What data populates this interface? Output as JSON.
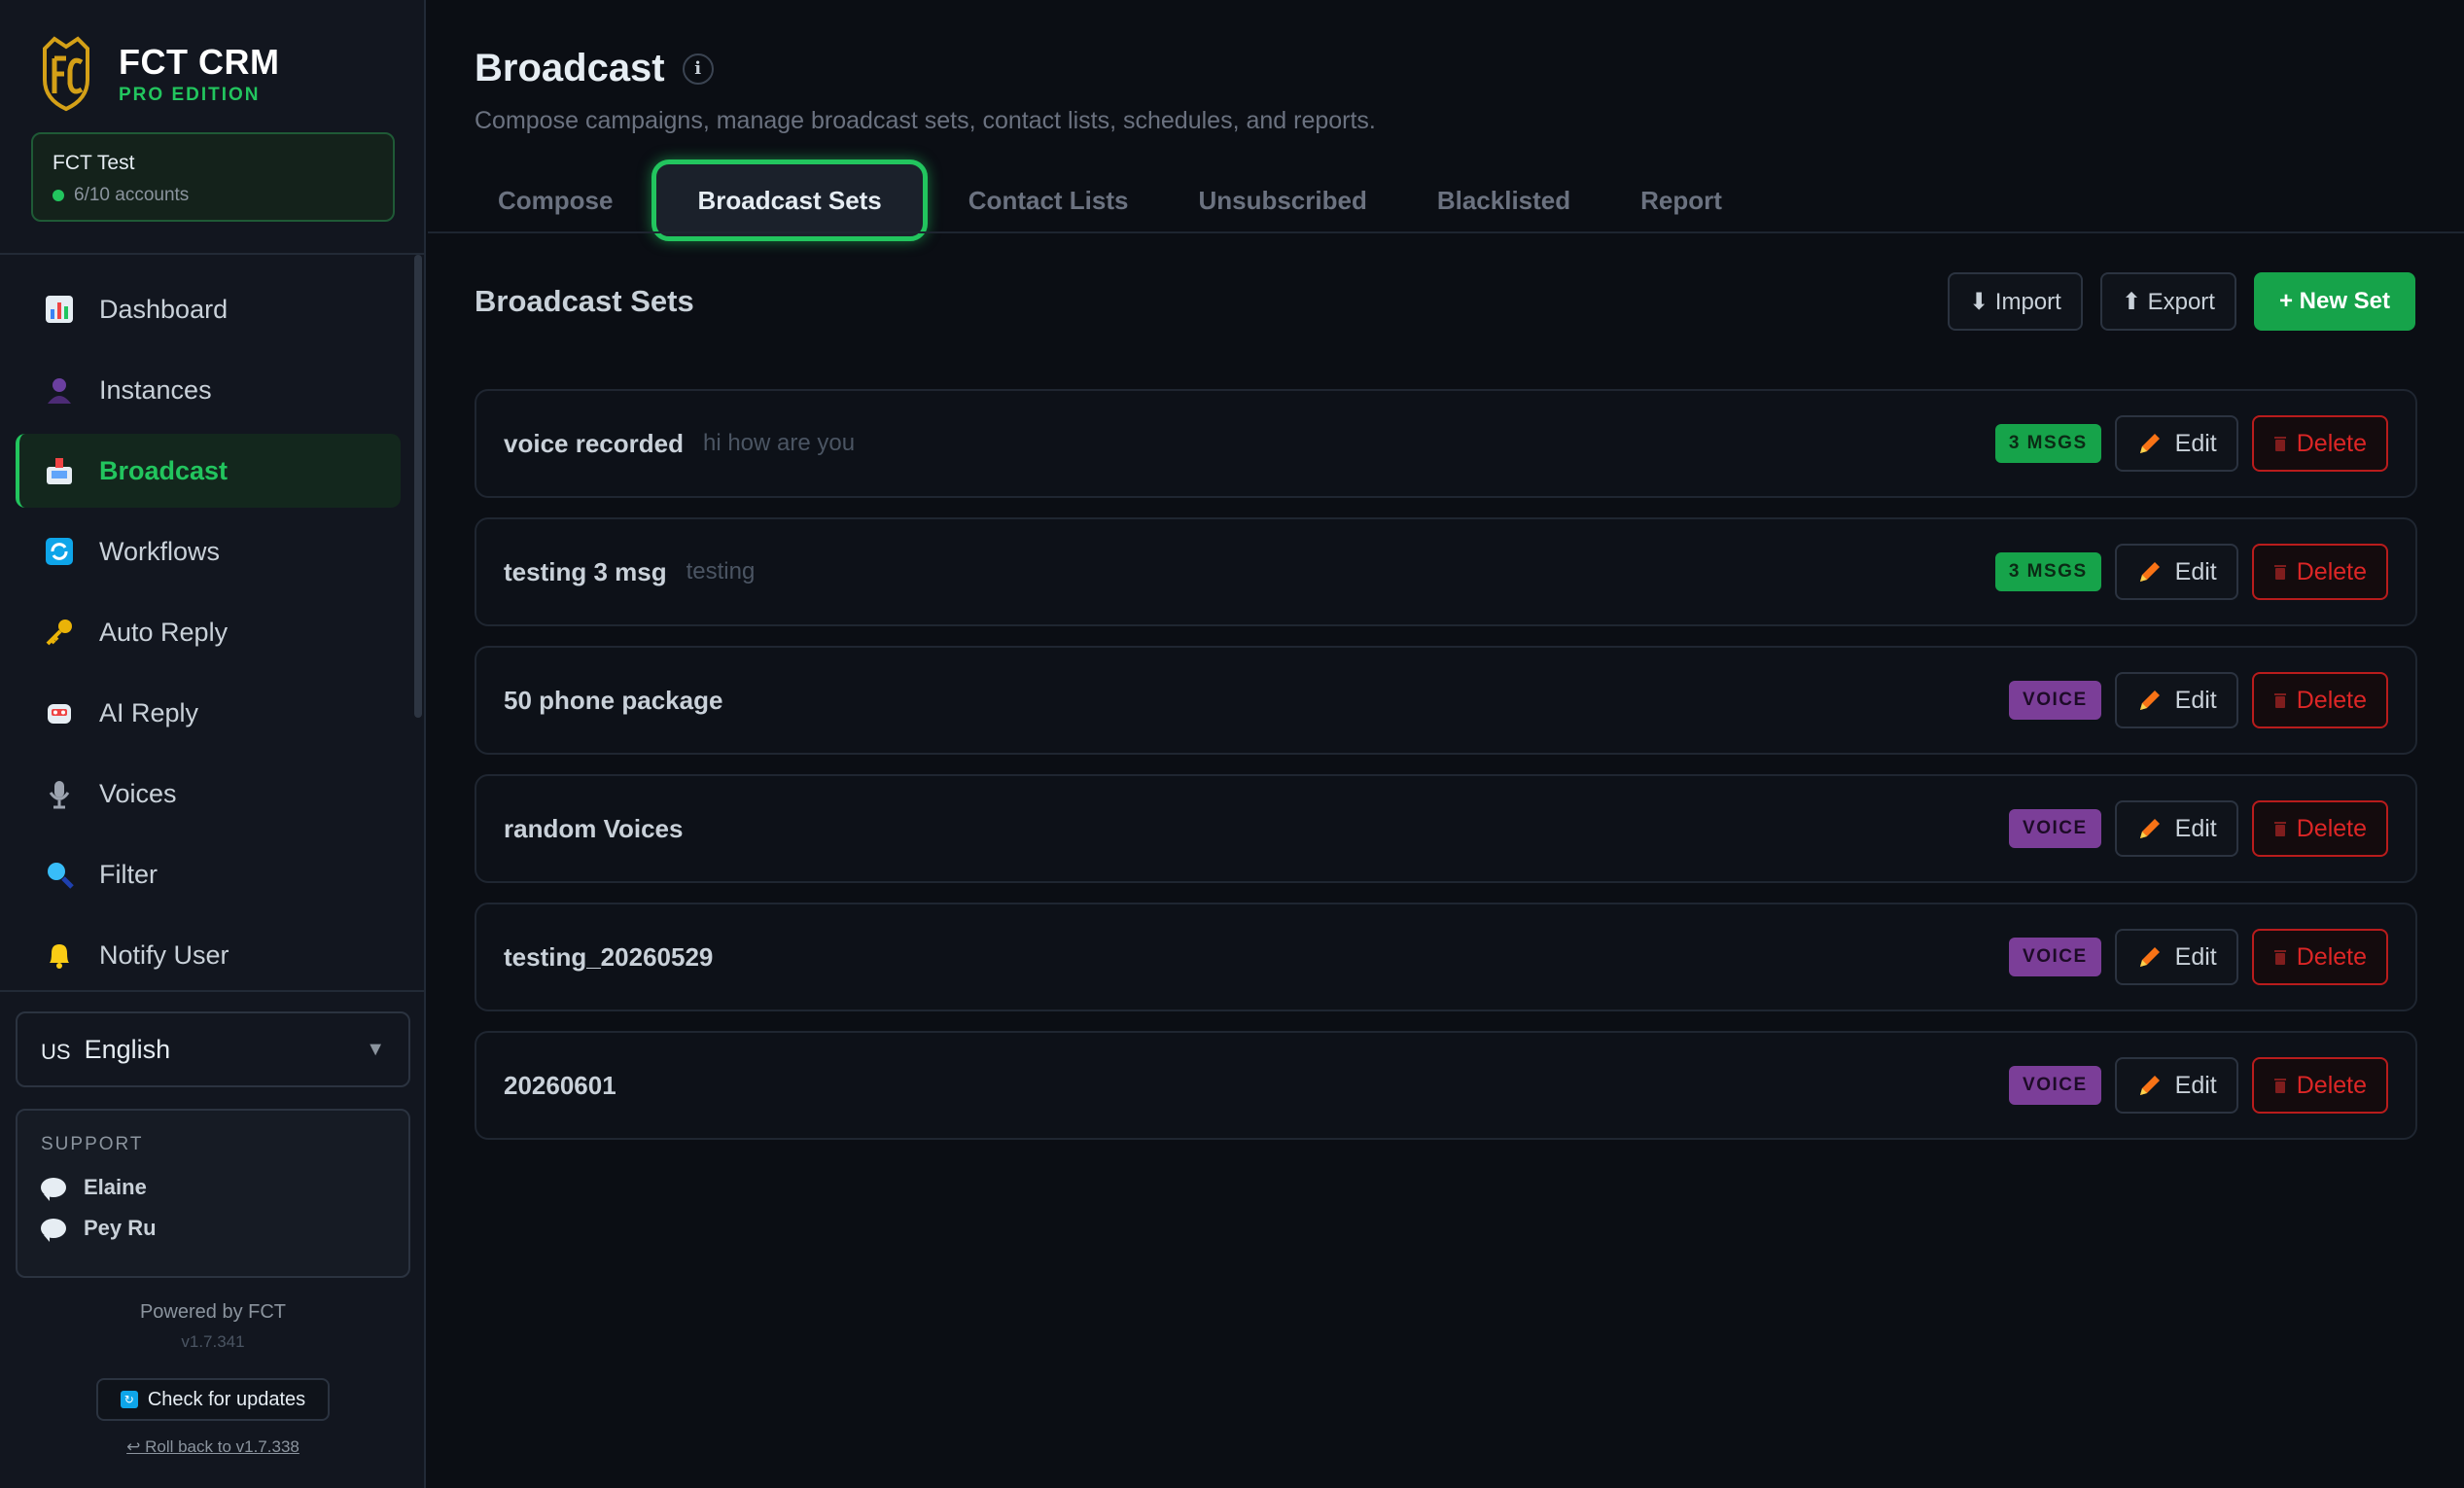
{
  "brand": {
    "name": "FCT CRM",
    "edition": "PRO EDITION"
  },
  "account": {
    "name": "FCT Test",
    "count": "6/10 accounts"
  },
  "nav": [
    {
      "label": "Dashboard",
      "icon": "chart-icon"
    },
    {
      "label": "Instances",
      "icon": "user-icon"
    },
    {
      "label": "Broadcast",
      "icon": "inbox-icon",
      "active": true
    },
    {
      "label": "Workflows",
      "icon": "refresh-icon"
    },
    {
      "label": "Auto Reply",
      "icon": "key-icon"
    },
    {
      "label": "AI Reply",
      "icon": "robot-icon"
    },
    {
      "label": "Voices",
      "icon": "microphone-icon"
    },
    {
      "label": "Filter",
      "icon": "magnifier-icon"
    },
    {
      "label": "Notify User",
      "icon": "bell-icon"
    }
  ],
  "language": {
    "flag": "US",
    "value": "English"
  },
  "support": {
    "label": "SUPPORT",
    "people": [
      "Elaine",
      "Pey Ru"
    ]
  },
  "footer": {
    "powered": "Powered by FCT",
    "version": "v1.7.341",
    "check_updates": "Check for updates",
    "rollback": "↩ Roll back to v1.7.338"
  },
  "page": {
    "title": "Broadcast",
    "info_glyph": "i",
    "subtitle": "Compose campaigns, manage broadcast sets, contact lists, schedules, and reports."
  },
  "tabs": [
    "Compose",
    "Broadcast Sets",
    "Contact Lists",
    "Unsubscribed",
    "Blacklisted",
    "Report"
  ],
  "active_tab": "Broadcast Sets",
  "section": {
    "title": "Broadcast Sets",
    "import_label": "⬇ Import",
    "export_label": "⬆ Export",
    "new_label": "+ New Set"
  },
  "sets": [
    {
      "name": "voice recorded",
      "desc": "hi how are you",
      "badge": "3 MSGS",
      "badge_type": "msgs"
    },
    {
      "name": "testing 3 msg",
      "desc": "testing",
      "badge": "3 MSGS",
      "badge_type": "msgs"
    },
    {
      "name": "50 phone package",
      "desc": "",
      "badge": "VOICE",
      "badge_type": "voice"
    },
    {
      "name": "random Voices",
      "desc": "",
      "badge": "VOICE",
      "badge_type": "voice"
    },
    {
      "name": "testing_20260529",
      "desc": "",
      "badge": "VOICE",
      "badge_type": "voice"
    },
    {
      "name": "20260601",
      "desc": "",
      "badge": "VOICE",
      "badge_type": "voice"
    }
  ],
  "row_actions": {
    "edit": "Edit",
    "delete": "Delete"
  },
  "colors": {
    "accent": "#22c55e",
    "danger": "#dc2626",
    "voice_badge": "#7b3e98",
    "background": "#0b0e14"
  }
}
